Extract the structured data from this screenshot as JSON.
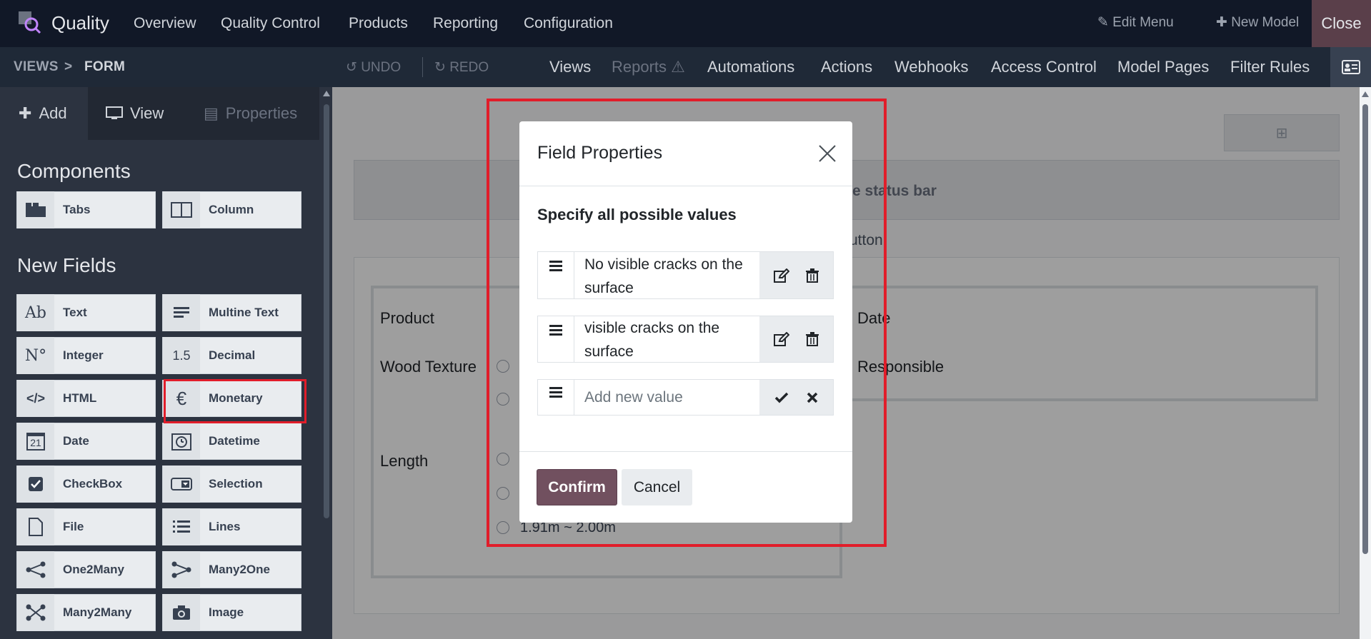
{
  "topbar": {
    "app_title": "Quality",
    "menu": [
      "Overview",
      "Quality Control",
      "Products",
      "Reporting",
      "Configuration"
    ],
    "edit_menu": "Edit Menu",
    "new_model": "New Model",
    "close": "Close"
  },
  "subbar": {
    "breadcrumb": [
      "VIEWS",
      "FORM"
    ],
    "breadcrumb_sep": ">",
    "undo": "UNDO",
    "redo": "REDO",
    "tabs": [
      "Views",
      "Reports",
      "Automations",
      "Actions",
      "Webhooks",
      "Access Control",
      "Model Pages",
      "Filter Rules"
    ]
  },
  "sidebar": {
    "tabs": [
      "Add",
      "View",
      "Properties"
    ],
    "components_title": "Components",
    "components": [
      {
        "label": "Tabs",
        "icon": "tabs-icon"
      },
      {
        "label": "Column",
        "icon": "column-icon"
      }
    ],
    "new_fields_title": "New Fields",
    "fields": [
      {
        "label": "Text",
        "icon": "Ab"
      },
      {
        "label": "Multine Text",
        "icon": "lines-icon"
      },
      {
        "label": "Integer",
        "icon": "N°"
      },
      {
        "label": "Decimal",
        "icon": "1.5"
      },
      {
        "label": "HTML",
        "icon": "</>"
      },
      {
        "label": "Monetary",
        "icon": "€"
      },
      {
        "label": "Date",
        "icon": "21"
      },
      {
        "label": "Datetime",
        "icon": "clock-icon"
      },
      {
        "label": "CheckBox",
        "icon": "checkbox-icon"
      },
      {
        "label": "Selection",
        "icon": "selection-icon"
      },
      {
        "label": "File",
        "icon": "file-icon"
      },
      {
        "label": "Lines",
        "icon": "list-icon"
      },
      {
        "label": "One2Many",
        "icon": "one2many-icon"
      },
      {
        "label": "Many2One",
        "icon": "many2one-icon"
      },
      {
        "label": "Many2Many",
        "icon": "many2many-icon"
      },
      {
        "label": "Image",
        "icon": "camera-icon"
      }
    ]
  },
  "canvas": {
    "statusbar_text": "e status bar",
    "button_text": "utton",
    "fields": [
      "Product",
      "Wood Texture",
      "Length",
      "Date",
      "Responsible"
    ],
    "last_option": "1.91m ~ 2.00m"
  },
  "modal": {
    "title": "Field Properties",
    "subtitle": "Specify all possible values",
    "values": [
      "No visible cracks on the surface",
      "visible cracks on the surface"
    ],
    "new_value_placeholder": "Add new value",
    "confirm": "Confirm",
    "cancel": "Cancel"
  },
  "colors": {
    "topbar": "#111827",
    "subbar": "#1f2937",
    "primary": "#71505f",
    "highlight": "#e11d2a"
  }
}
